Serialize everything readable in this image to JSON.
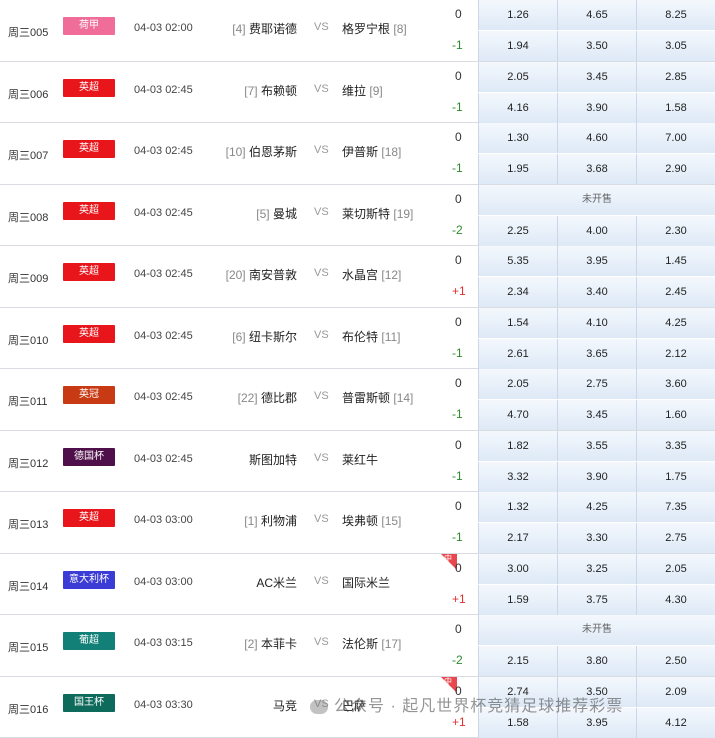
{
  "matches": [
    {
      "num": "周三005",
      "league": "荷甲",
      "color": "#f06d9a",
      "time": "04-03 02:00",
      "home_rank": "[4]",
      "home": "费耶诺德",
      "vs": "VS",
      "away": "格罗宁根",
      "away_rank": "[8]",
      "hc0": "0",
      "hc1": "-1",
      "hc1_type": "neg",
      "odds0": [
        "1.26",
        "4.65",
        "8.25"
      ],
      "odds1": [
        "1.94",
        "3.50",
        "3.05"
      ],
      "closed": false,
      "badge": false
    },
    {
      "num": "周三006",
      "league": "英超",
      "color": "#e8151b",
      "time": "04-03 02:45",
      "home_rank": "[7]",
      "home": "布赖顿",
      "vs": "VS",
      "away": "维拉",
      "away_rank": "[9]",
      "hc0": "0",
      "hc1": "-1",
      "hc1_type": "neg",
      "odds0": [
        "2.05",
        "3.45",
        "2.85"
      ],
      "odds1": [
        "4.16",
        "3.90",
        "1.58"
      ],
      "closed": false,
      "badge": false
    },
    {
      "num": "周三007",
      "league": "英超",
      "color": "#e8151b",
      "time": "04-03 02:45",
      "home_rank": "[10]",
      "home": "伯恩茅斯",
      "vs": "VS",
      "away": "伊普斯",
      "away_rank": "[18]",
      "hc0": "0",
      "hc1": "-1",
      "hc1_type": "neg",
      "odds0": [
        "1.30",
        "4.60",
        "7.00"
      ],
      "odds1": [
        "1.95",
        "3.68",
        "2.90"
      ],
      "closed": false,
      "badge": false
    },
    {
      "num": "周三008",
      "league": "英超",
      "color": "#e8151b",
      "time": "04-03 02:45",
      "home_rank": "[5]",
      "home": "曼城",
      "vs": "VS",
      "away": "莱切斯特",
      "away_rank": "[19]",
      "hc0": "0",
      "hc1": "-2",
      "hc1_type": "neg",
      "odds0": [],
      "odds1": [
        "2.25",
        "4.00",
        "2.30"
      ],
      "closed": true,
      "closed_label": "未开售",
      "badge": false
    },
    {
      "num": "周三009",
      "league": "英超",
      "color": "#e8151b",
      "time": "04-03 02:45",
      "home_rank": "[20]",
      "home": "南安普敦",
      "vs": "VS",
      "away": "水晶宫",
      "away_rank": "[12]",
      "hc0": "0",
      "hc1": "+1",
      "hc1_type": "pos",
      "odds0": [
        "5.35",
        "3.95",
        "1.45"
      ],
      "odds1": [
        "2.34",
        "3.40",
        "2.45"
      ],
      "closed": false,
      "badge": false
    },
    {
      "num": "周三010",
      "league": "英超",
      "color": "#e8151b",
      "time": "04-03 02:45",
      "home_rank": "[6]",
      "home": "纽卡斯尔",
      "vs": "VS",
      "away": "布伦特",
      "away_rank": "[11]",
      "hc0": "0",
      "hc1": "-1",
      "hc1_type": "neg",
      "odds0": [
        "1.54",
        "4.10",
        "4.25"
      ],
      "odds1": [
        "2.61",
        "3.65",
        "2.12"
      ],
      "closed": false,
      "badge": false
    },
    {
      "num": "周三011",
      "league": "英冠",
      "color": "#c73a14",
      "time": "04-03 02:45",
      "home_rank": "[22]",
      "home": "德比郡",
      "vs": "VS",
      "away": "普雷斯顿",
      "away_rank": "[14]",
      "hc0": "0",
      "hc1": "-1",
      "hc1_type": "neg",
      "odds0": [
        "2.05",
        "2.75",
        "3.60"
      ],
      "odds1": [
        "4.70",
        "3.45",
        "1.60"
      ],
      "closed": false,
      "badge": false
    },
    {
      "num": "周三012",
      "league": "德国杯",
      "color": "#4f0f4a",
      "time": "04-03 02:45",
      "home_rank": "",
      "home": "斯图加特",
      "vs": "VS",
      "away": "莱红牛",
      "away_rank": "",
      "hc0": "0",
      "hc1": "-1",
      "hc1_type": "neg",
      "odds0": [
        "1.82",
        "3.55",
        "3.35"
      ],
      "odds1": [
        "3.32",
        "3.90",
        "1.75"
      ],
      "closed": false,
      "badge": false
    },
    {
      "num": "周三013",
      "league": "英超",
      "color": "#e8151b",
      "time": "04-03 03:00",
      "home_rank": "[1]",
      "home": "利物浦",
      "vs": "VS",
      "away": "埃弗顿",
      "away_rank": "[15]",
      "hc0": "0",
      "hc1": "-1",
      "hc1_type": "neg",
      "odds0": [
        "1.32",
        "4.25",
        "7.35"
      ],
      "odds1": [
        "2.17",
        "3.30",
        "2.75"
      ],
      "closed": false,
      "badge": false
    },
    {
      "num": "周三014",
      "league": "意大利杯",
      "color": "#3b3bd6",
      "time": "04-03 03:00",
      "home_rank": "",
      "home": "AC米兰",
      "vs": "VS",
      "away": "国际米兰",
      "away_rank": "",
      "hc0": "0",
      "hc1": "+1",
      "hc1_type": "pos",
      "odds0": [
        "3.00",
        "3.25",
        "2.05"
      ],
      "odds1": [
        "1.59",
        "3.75",
        "4.30"
      ],
      "closed": false,
      "badge": true,
      "badge_label": "中"
    },
    {
      "num": "周三015",
      "league": "葡超",
      "color": "#128077",
      "time": "04-03 03:15",
      "home_rank": "[2]",
      "home": "本菲卡",
      "vs": "VS",
      "away": "法伦斯",
      "away_rank": "[17]",
      "hc0": "0",
      "hc1": "-2",
      "hc1_type": "neg",
      "odds0": [],
      "odds1": [
        "2.15",
        "3.80",
        "2.50"
      ],
      "closed": true,
      "closed_label": "未开售",
      "badge": false
    },
    {
      "num": "周三016",
      "league": "国王杯",
      "color": "#0e6a5a",
      "time": "04-03 03:30",
      "home_rank": "",
      "home": "马竞",
      "vs": "VS",
      "away": "巴萨",
      "away_rank": "",
      "hc0": "0",
      "hc1": "+1",
      "hc1_type": "pos",
      "odds0": [
        "2.74",
        "3.50",
        "2.09"
      ],
      "odds1": [
        "1.58",
        "3.95",
        "4.12"
      ],
      "closed": false,
      "badge": true,
      "badge_label": "中"
    }
  ],
  "watermark": "公众号 · 起凡世界杯竞猜足球推荐彩票"
}
